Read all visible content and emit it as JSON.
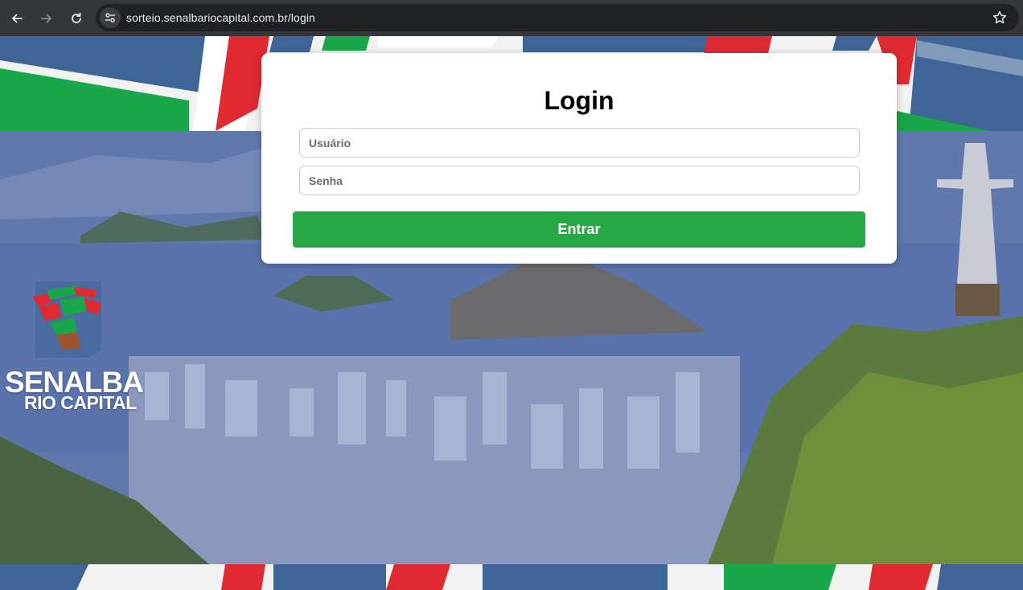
{
  "browser": {
    "url": "sorteio.senalbariocapital.com.br/login",
    "back_icon": "back-arrow-icon",
    "forward_icon": "forward-arrow-icon",
    "reload_icon": "reload-icon",
    "site_info_icon": "site-settings-icon",
    "bookmark_icon": "star-icon"
  },
  "login": {
    "title": "Login",
    "username_placeholder": "Usuário",
    "password_placeholder": "Senha",
    "submit_label": "Entrar"
  },
  "logo": {
    "line1": "SENALBA",
    "line2": "RIO CAPITAL"
  },
  "colors": {
    "button": "#28a745",
    "card": "#ffffff",
    "chrome": "#35363a",
    "omnibox": "#202124"
  }
}
